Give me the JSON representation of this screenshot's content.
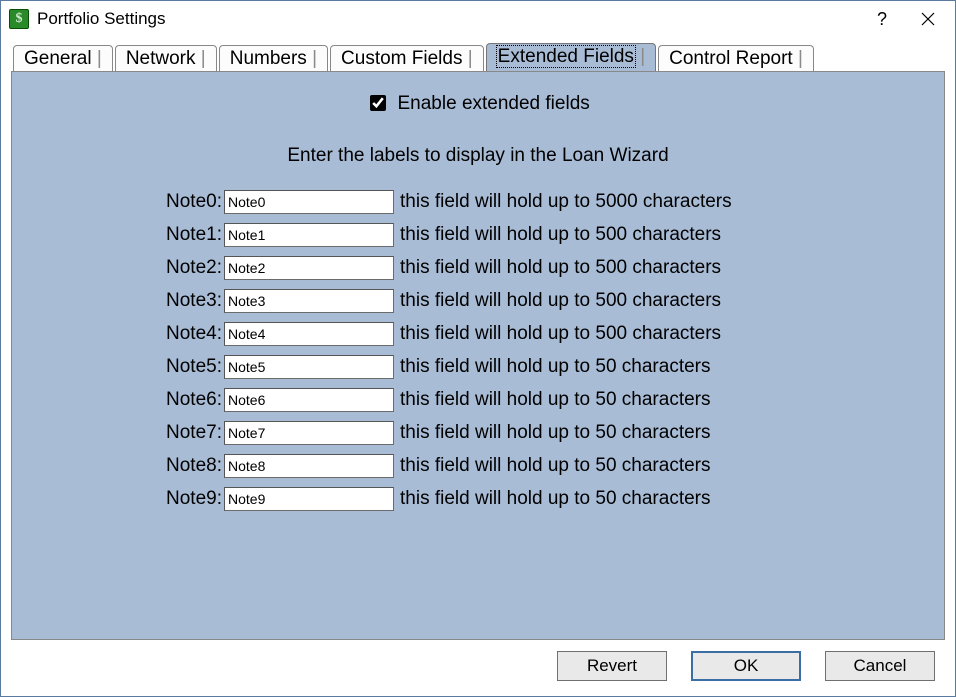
{
  "window": {
    "title": "Portfolio Settings"
  },
  "tabs": {
    "general": "General",
    "network": "Network",
    "numbers": "Numbers",
    "custom_fields": "Custom Fields",
    "extended_fields": "Extended Fields",
    "control_report": "Control Report"
  },
  "panel": {
    "enable_label": "Enable extended fields",
    "enable_checked": true,
    "instructions": "Enter the labels to display in the Loan Wizard",
    "rows": [
      {
        "label": "Note0:",
        "value": "Note0",
        "hint": "this field will hold up to 5000 characters"
      },
      {
        "label": "Note1:",
        "value": "Note1",
        "hint": "this field will hold up to 500 characters"
      },
      {
        "label": "Note2:",
        "value": "Note2",
        "hint": "this field will hold up to 500 characters"
      },
      {
        "label": "Note3:",
        "value": "Note3",
        "hint": "this field will hold up to 500 characters"
      },
      {
        "label": "Note4:",
        "value": "Note4",
        "hint": "this field will hold up to 500 characters"
      },
      {
        "label": "Note5:",
        "value": "Note5",
        "hint": "this field will hold up to 50 characters"
      },
      {
        "label": "Note6:",
        "value": "Note6",
        "hint": "this field will hold up to 50 characters"
      },
      {
        "label": "Note7:",
        "value": "Note7",
        "hint": "this field will hold up to 50 characters"
      },
      {
        "label": "Note8:",
        "value": "Note8",
        "hint": "this field will hold up to 50 characters"
      },
      {
        "label": "Note9:",
        "value": "Note9",
        "hint": "this field will hold up to 50 characters"
      }
    ]
  },
  "buttons": {
    "revert": "Revert",
    "ok": "OK",
    "cancel": "Cancel"
  }
}
